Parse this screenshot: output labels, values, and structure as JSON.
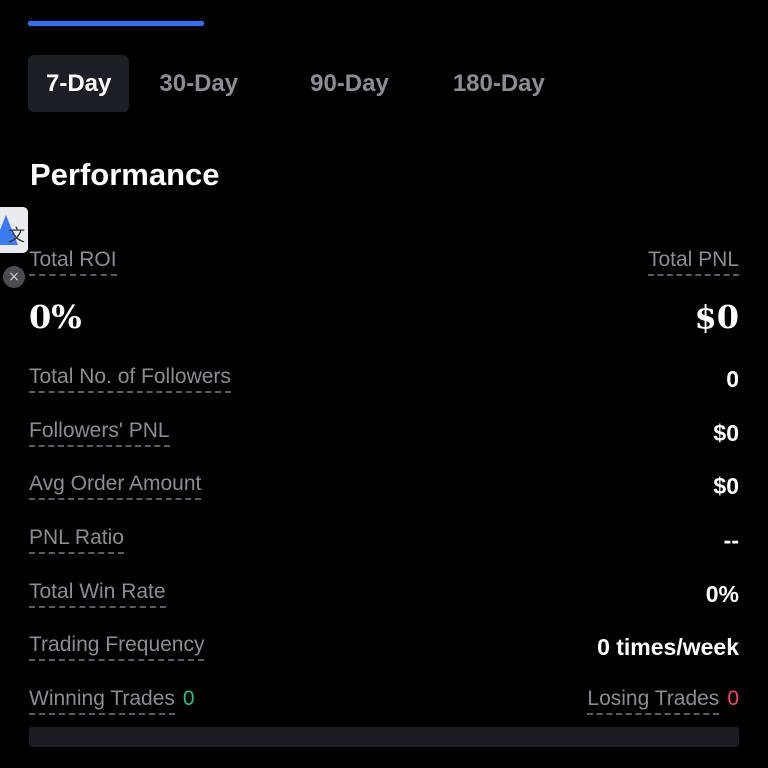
{
  "tabs": [
    {
      "label": "7-Day",
      "active": true
    },
    {
      "label": "30-Day",
      "active": false
    },
    {
      "label": "90-Day",
      "active": false
    },
    {
      "label": "180-Day",
      "active": false
    }
  ],
  "section_title": "Performance",
  "summary": {
    "roi_label": "Total ROI",
    "roi_value": "0%",
    "pnl_label": "Total PNL",
    "pnl_value": "$0"
  },
  "stats": [
    {
      "label": "Total No. of Followers",
      "value": "0"
    },
    {
      "label": "Followers' PNL",
      "value": "$0"
    },
    {
      "label": "Avg Order Amount",
      "value": "$0"
    },
    {
      "label": "PNL Ratio",
      "value": "--"
    },
    {
      "label": "Total Win Rate",
      "value": "0%"
    },
    {
      "label": "Trading Frequency",
      "value": "0 times/week"
    }
  ],
  "trades": {
    "winning_label": "Winning Trades",
    "winning_value": "0",
    "losing_label": "Losing Trades",
    "losing_value": "0"
  },
  "translate_widget": {
    "icon": "translate-icon",
    "glyph": "文",
    "close_glyph": "×"
  },
  "colors": {
    "accent": "#2f6df5",
    "positive": "#2ebd85",
    "negative": "#f6465d",
    "muted_text": "#8a8d93",
    "background": "#000000"
  }
}
